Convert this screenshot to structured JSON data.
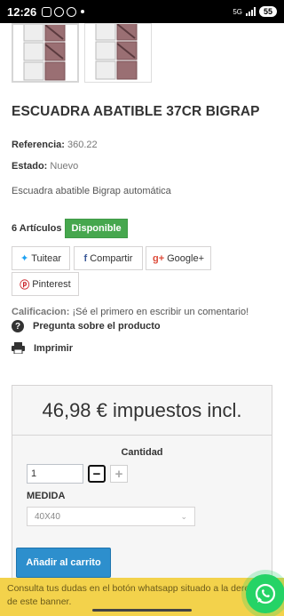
{
  "status": {
    "time": "12:26",
    "net": "5G",
    "battery": "55"
  },
  "product": {
    "title": "ESCUADRA ABATIBLE 37CR BIGRAP",
    "ref_label": "Referencia:",
    "ref_value": "360.22",
    "state_label": "Estado:",
    "state_value": "Nuevo",
    "description": "Escuadra abatible Bigrap automática",
    "stock_count": "6 Artículos",
    "availability": "Disponible"
  },
  "share": {
    "twitter": "Tuitear",
    "facebook": "Compartir",
    "google": "Google+",
    "pinterest": "Pinterest"
  },
  "rating": {
    "label": "Calificacion:",
    "text": "¡Sé el primero en escribir un comentario!"
  },
  "links": {
    "ask": "Pregunta sobre el producto",
    "print": "Imprimir"
  },
  "buy": {
    "price": "46,98 € impuestos incl.",
    "quantity_label": "Cantidad",
    "quantity_value": "1",
    "measure_label": "MEDIDA",
    "measure_value": "40X40",
    "add_to_cart": "Añadir al carrito"
  },
  "banner": {
    "text": "Consulta tus dudas en el botón whatsapp situado a la derecha de este banner."
  },
  "colors": {
    "accent": "#2d8fcd",
    "available": "#46a74e",
    "banner": "#f3d24b",
    "whatsapp": "#25d366"
  }
}
